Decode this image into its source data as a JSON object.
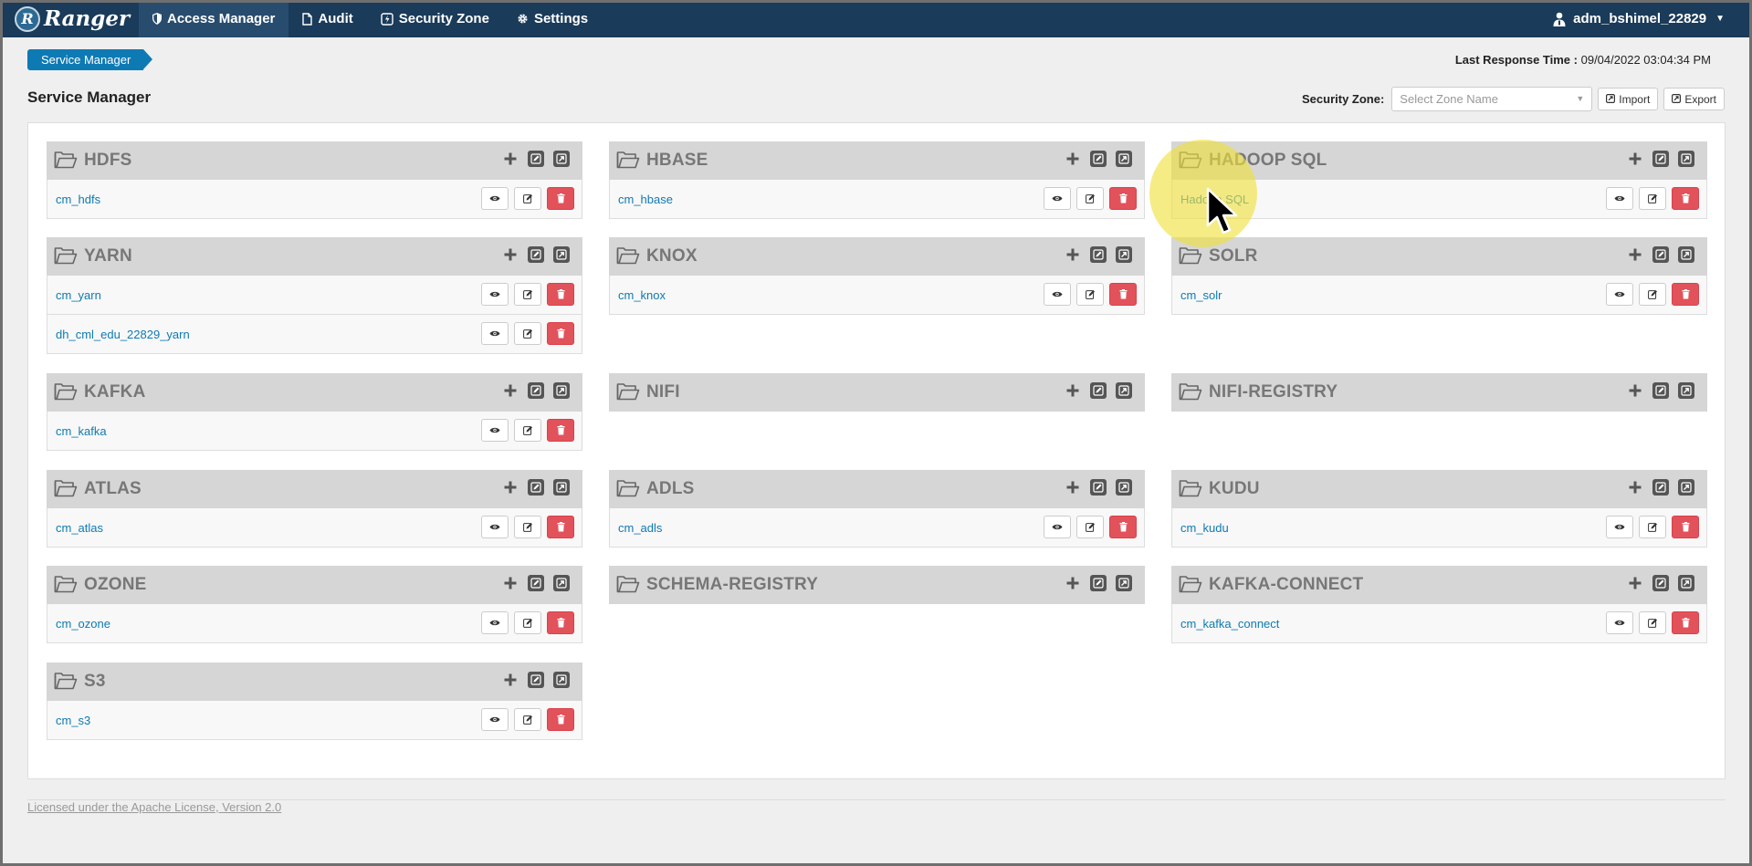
{
  "brand": {
    "logo_letter": "R",
    "name": "Ranger"
  },
  "nav": [
    {
      "label": "Access Manager",
      "icon": "shield-icon",
      "active": true
    },
    {
      "label": "Audit",
      "icon": "file-icon",
      "active": false
    },
    {
      "label": "Security Zone",
      "icon": "zone-icon",
      "active": false
    },
    {
      "label": "Settings",
      "icon": "gear-icon",
      "active": false
    }
  ],
  "user": {
    "name": "adm_bshimel_22829",
    "icon": "user-icon"
  },
  "breadcrumb": "Service Manager",
  "last_response": {
    "label": "Last Response Time :",
    "value": "09/04/2022 03:04:34 PM"
  },
  "page_title": "Service Manager",
  "zone": {
    "label": "Security Zone:",
    "placeholder": "Select Zone Name",
    "import_label": "Import",
    "export_label": "Export"
  },
  "cards": [
    {
      "title": "HDFS",
      "services": [
        "cm_hdfs"
      ]
    },
    {
      "title": "HBASE",
      "services": [
        "cm_hbase"
      ]
    },
    {
      "title": "HADOOP SQL",
      "services": [
        "Hadoop SQL"
      ]
    },
    {
      "title": "YARN",
      "services": [
        "cm_yarn",
        "dh_cml_edu_22829_yarn"
      ]
    },
    {
      "title": "KNOX",
      "services": [
        "cm_knox"
      ]
    },
    {
      "title": "SOLR",
      "services": [
        "cm_solr"
      ]
    },
    {
      "title": "KAFKA",
      "services": [
        "cm_kafka"
      ]
    },
    {
      "title": "NIFI",
      "services": []
    },
    {
      "title": "NIFI-REGISTRY",
      "services": []
    },
    {
      "title": "ATLAS",
      "services": [
        "cm_atlas"
      ]
    },
    {
      "title": "ADLS",
      "services": [
        "cm_adls"
      ]
    },
    {
      "title": "KUDU",
      "services": [
        "cm_kudu"
      ]
    },
    {
      "title": "OZONE",
      "services": [
        "cm_ozone"
      ]
    },
    {
      "title": "SCHEMA-REGISTRY",
      "services": []
    },
    {
      "title": "KAFKA-CONNECT",
      "services": [
        "cm_kafka_connect"
      ]
    },
    {
      "title": "S3",
      "services": [
        "cm_s3"
      ]
    }
  ],
  "footer": "Licensed under the Apache License, Version 2.0",
  "colors": {
    "navbar": "#1a3b5a",
    "accent": "#0e7ab4",
    "delete": "#e2525b"
  }
}
